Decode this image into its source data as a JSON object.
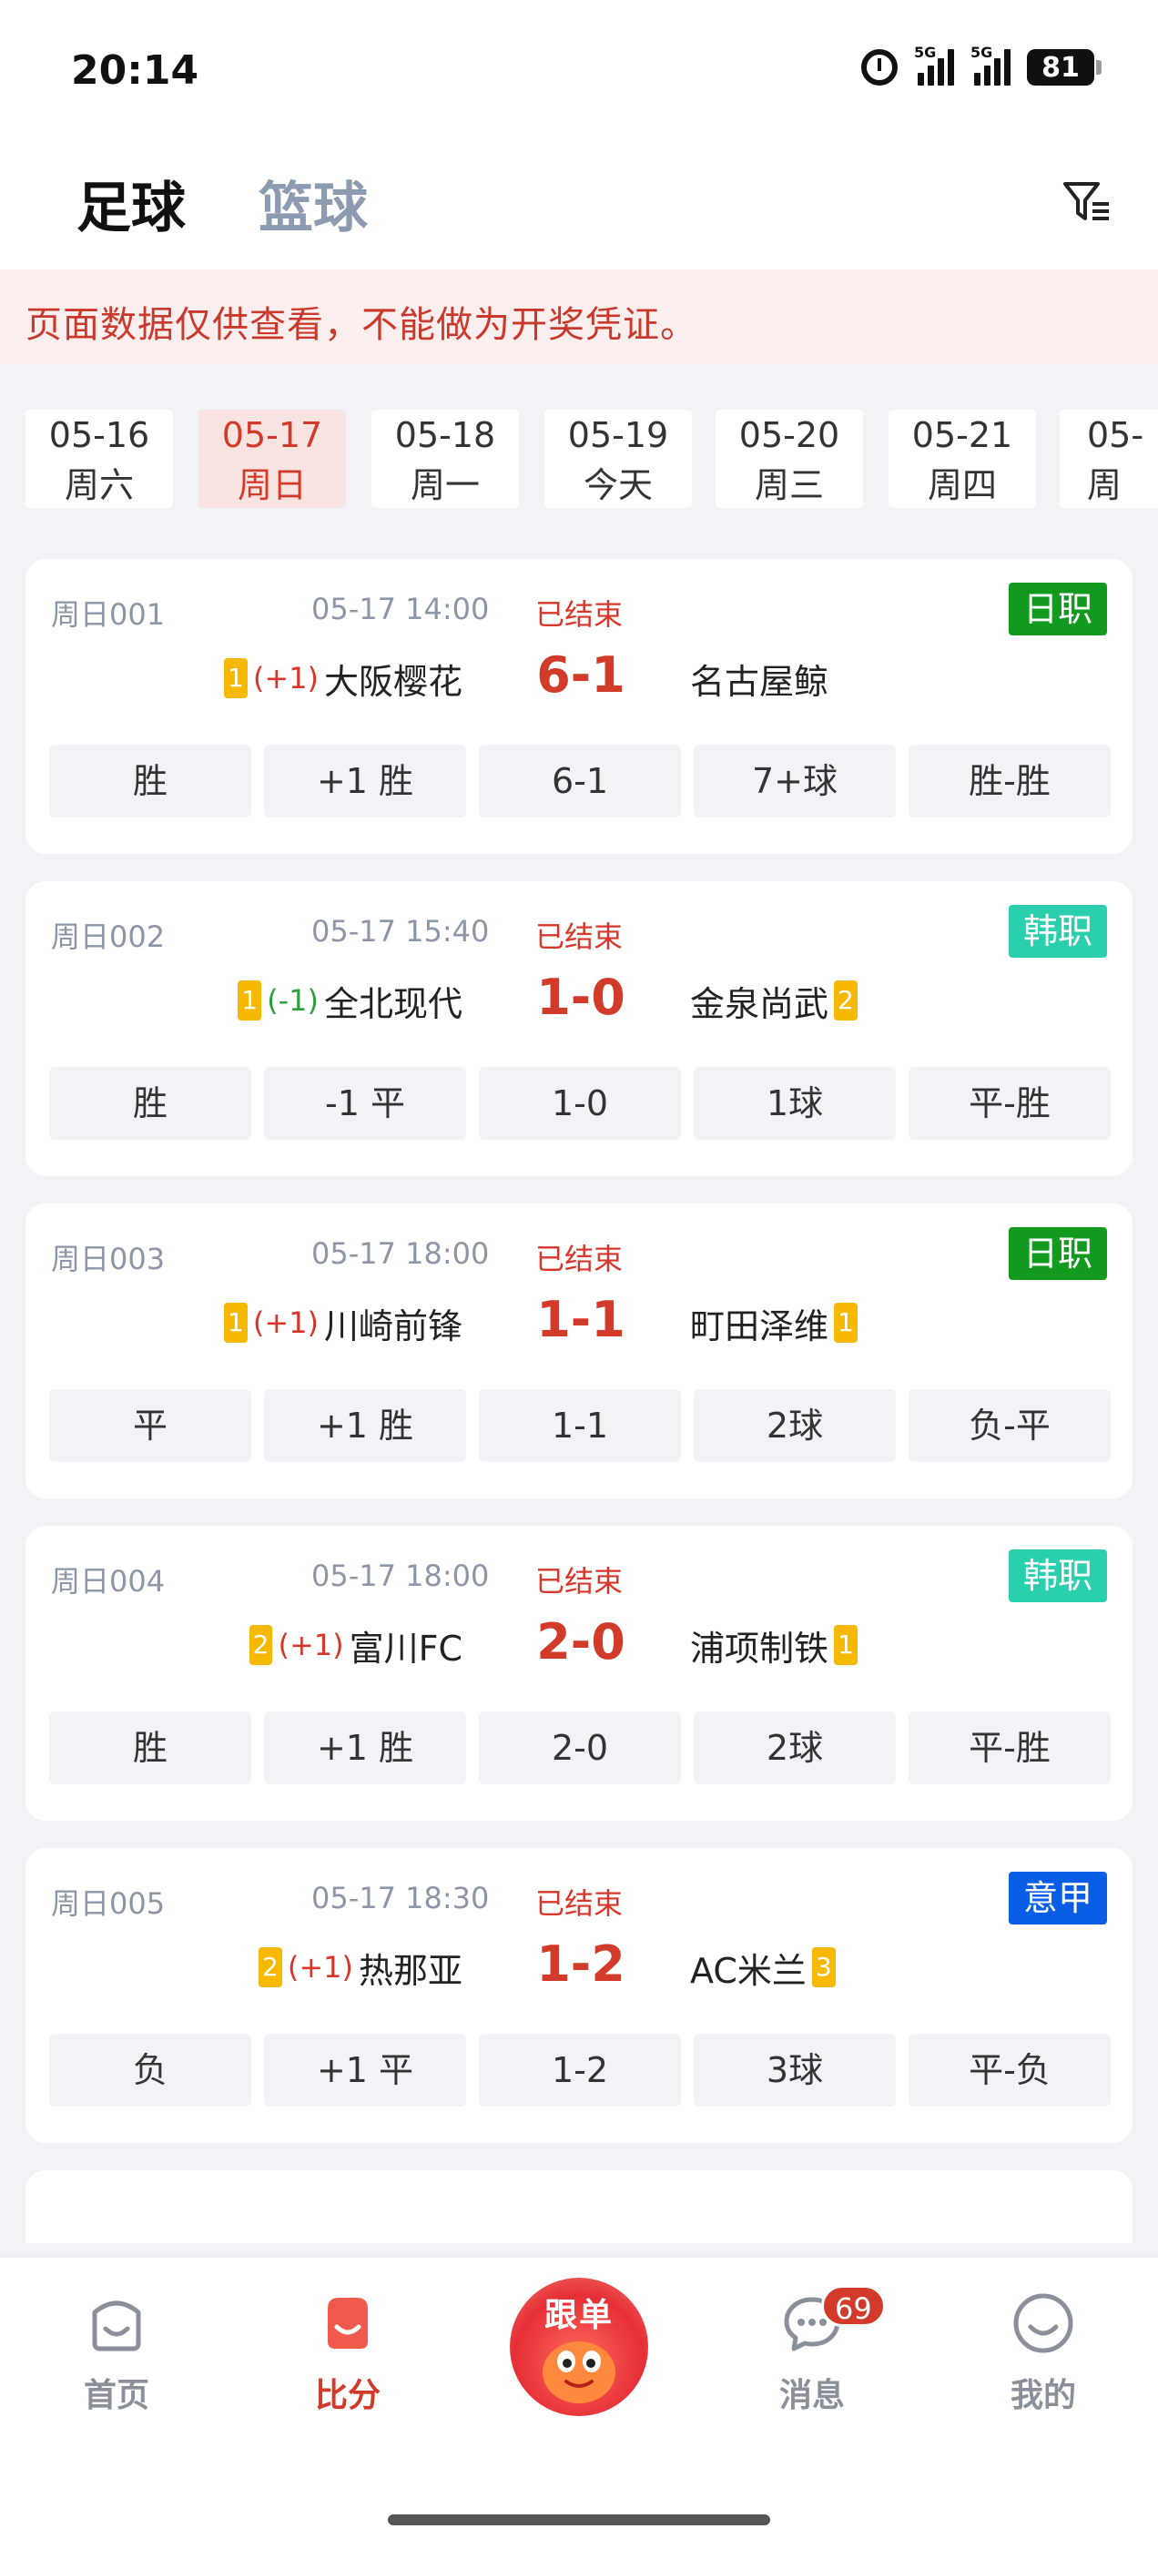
{
  "status_bar": {
    "time": "20:14",
    "network_1": "5G",
    "network_2": "5G",
    "battery": "81"
  },
  "header": {
    "tab_football": "足球",
    "tab_basketball": "篮球"
  },
  "notice": "页面数据仅供查看，不能做为开奖凭证。",
  "dates": [
    {
      "date": "05-16",
      "weekday": "周六",
      "active": false
    },
    {
      "date": "05-17",
      "weekday": "周日",
      "active": true
    },
    {
      "date": "05-18",
      "weekday": "周一",
      "active": false
    },
    {
      "date": "05-19",
      "weekday": "今天",
      "active": false
    },
    {
      "date": "05-20",
      "weekday": "周三",
      "active": false
    },
    {
      "date": "05-21",
      "weekday": "周四",
      "active": false
    },
    {
      "date": "05-",
      "weekday": "周",
      "active": false
    }
  ],
  "matches": [
    {
      "no": "周日001",
      "time": "05-17 14:00",
      "status": "已结束",
      "league": "日职",
      "league_color": "#129a1f",
      "home_rank": "1",
      "handicap": "(+1)",
      "home": "大阪樱花",
      "score": "6-1",
      "away": "名古屋鲸",
      "away_rank": "",
      "results": [
        "胜",
        "+1 胜",
        "6-1",
        "7+球",
        "胜-胜"
      ]
    },
    {
      "no": "周日002",
      "time": "05-17 15:40",
      "status": "已结束",
      "league": "韩职",
      "league_color": "#2ad0ad",
      "home_rank": "1",
      "handicap": "(-1)",
      "home": "全北现代",
      "score": "1-0",
      "away": "金泉尚武",
      "away_rank": "2",
      "results": [
        "胜",
        "-1 平",
        "1-0",
        "1球",
        "平-胜"
      ]
    },
    {
      "no": "周日003",
      "time": "05-17 18:00",
      "status": "已结束",
      "league": "日职",
      "league_color": "#129a1f",
      "home_rank": "1",
      "handicap": "(+1)",
      "home": "川崎前锋",
      "score": "1-1",
      "away": "町田泽维",
      "away_rank": "1",
      "results": [
        "平",
        "+1 胜",
        "1-1",
        "2球",
        "负-平"
      ]
    },
    {
      "no": "周日004",
      "time": "05-17 18:00",
      "status": "已结束",
      "league": "韩职",
      "league_color": "#2ad0ad",
      "home_rank": "2",
      "handicap": "(+1)",
      "home": "富川FC",
      "score": "2-0",
      "away": "浦项制铁",
      "away_rank": "1",
      "results": [
        "胜",
        "+1 胜",
        "2-0",
        "2球",
        "平-胜"
      ]
    },
    {
      "no": "周日005",
      "time": "05-17 18:30",
      "status": "已结束",
      "league": "意甲",
      "league_color": "#0a5ee6",
      "home_rank": "2",
      "handicap": "(+1)",
      "home": "热那亚",
      "score": "1-2",
      "away": "AC米兰",
      "away_rank": "3",
      "results": [
        "负",
        "+1 平",
        "1-2",
        "3球",
        "平-负"
      ]
    }
  ],
  "bottom_nav": {
    "home": "首页",
    "score": "比分",
    "follow": "跟单",
    "messages": "消息",
    "messages_badge": "69",
    "mine": "我的"
  }
}
